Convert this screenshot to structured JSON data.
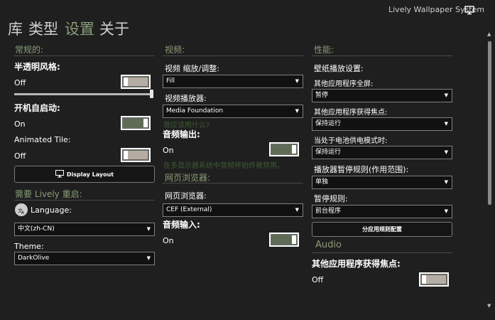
{
  "window": {
    "title": "Lively Wallpaper System",
    "monitor_icon": "monitor-icon"
  },
  "nav": {
    "tabs": [
      "库",
      "类型",
      "设置",
      "关于"
    ],
    "active_index": 2
  },
  "general": {
    "header": "常规的:",
    "transparent_label": "半透明风格:",
    "transparent_state": "Off",
    "autostart_label": "开机自启动:",
    "autostart_state": "On",
    "animated_tile_label": "Animated Tile:",
    "animated_tile_state": "Off",
    "display_layout_button": "Display Layout",
    "restart_header": "需要 Lively 重启:",
    "language_label": "Language:",
    "language_value": "中文(zh-CN)",
    "theme_label": "Theme:",
    "theme_value": "DarkOlive"
  },
  "video": {
    "header": "视频:",
    "scale_label": "视频 缩放/调整:",
    "scale_value": "Fill",
    "player_label": "视频播放器:",
    "player_value": "Media Foundation",
    "player_hint": "我应该用什么?",
    "audio_output_label": "音频输出:",
    "audio_output_state": "On",
    "audio_output_hint": "在多显示器系统中音频将始终被禁用。"
  },
  "web": {
    "header": "网页浏览器:",
    "browser_label": "网页浏览器:",
    "browser_value": "CEF (External)",
    "audio_input_label": "音频输入:",
    "audio_input_state": "On"
  },
  "performance": {
    "header": "性能:",
    "playback_label": "壁纸播放设置:",
    "fullscreen_label": "其他应用程序全屏:",
    "fullscreen_value": "暂停",
    "focus_label": "其他应用程序获得焦点:",
    "focus_value": "保持运行",
    "battery_label": "当处于电池供电模式时:",
    "battery_value": "保持运行",
    "pause_rule_label": "播放器暂停规则(作用范围):",
    "pause_rule_value": "单独",
    "pause_label": "暂停规则:",
    "pause_value": "前台程序",
    "app_rules_button": "分应用规则配置",
    "audio_header": "Audio",
    "audio_focus_label": "其他应用程序获得焦点:",
    "audio_focus_state": "Off"
  },
  "colors": {
    "accent": "#8a9d78",
    "background": "#1f1f1f",
    "toggle_on": "#5e6c56",
    "toggle_off": "#b5ada4"
  }
}
